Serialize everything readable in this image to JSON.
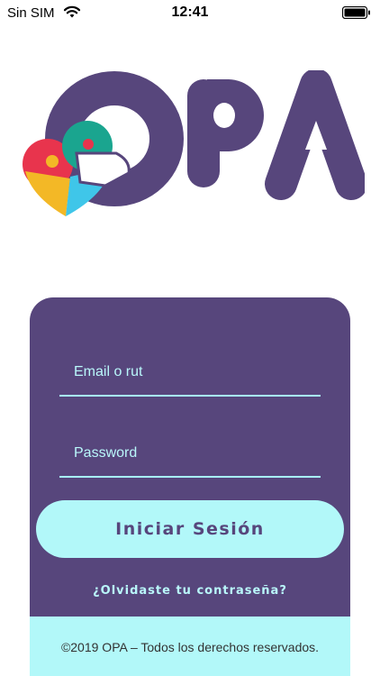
{
  "status_bar": {
    "carrier": "Sin SIM",
    "time": "12:41",
    "wifi_icon": "wifi-icon",
    "battery_icon": "battery-icon"
  },
  "logo": {
    "text": "OPA",
    "brand_color": "#57467c",
    "icon": "puzzle-heart-icon"
  },
  "login": {
    "email_label": "Email o rut",
    "password_label": "Password",
    "submit_label": "Iniciar Sesión",
    "forgot_password": "¿Olvidaste tu contraseña?"
  },
  "footer": {
    "copyright": "©2019 OPA – Todos los derechos reservados."
  },
  "colors": {
    "card_background": "#57467c",
    "accent": "#b2f8f9"
  }
}
